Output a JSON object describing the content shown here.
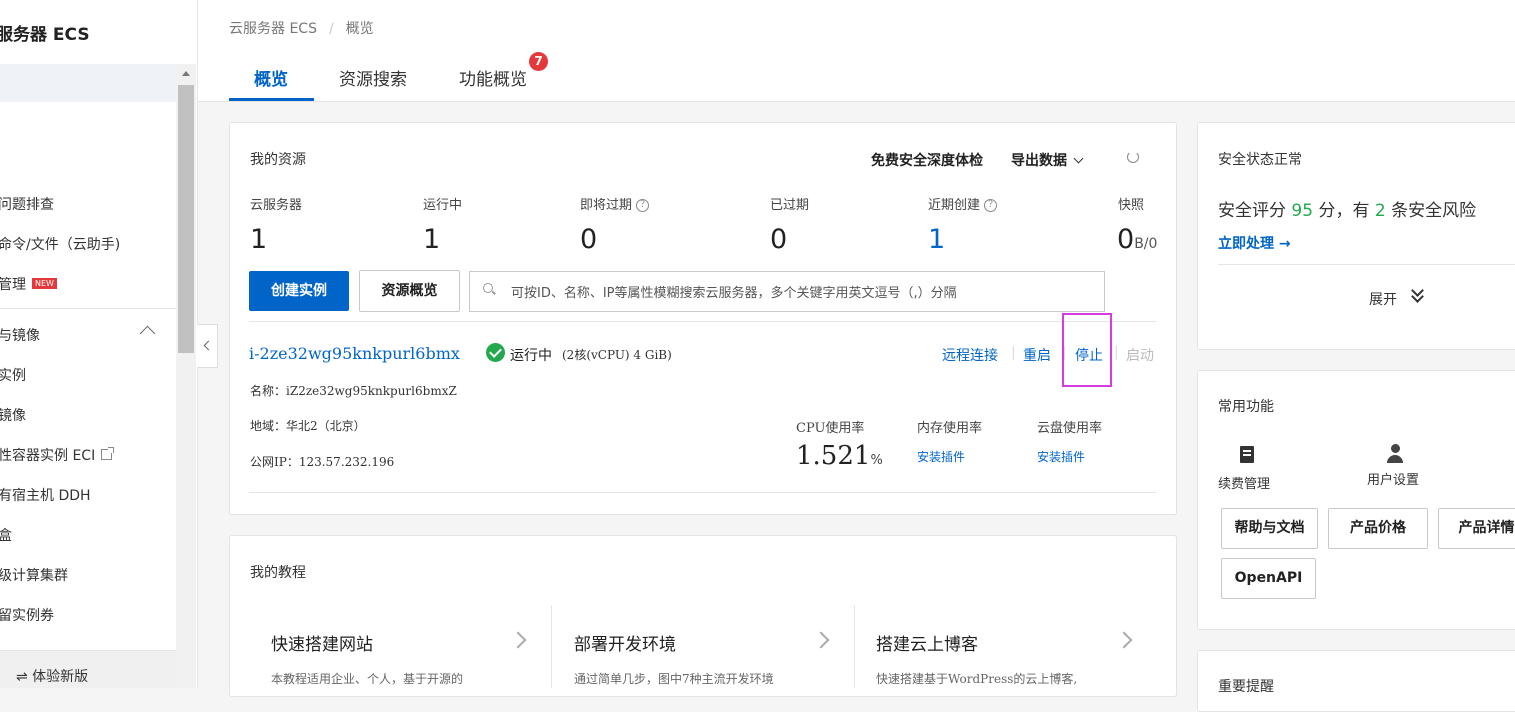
{
  "sidebar": {
    "title": "服务器 ECS",
    "items": [
      {
        "label": "问题排查"
      },
      {
        "label": "命令/文件（云助手)"
      },
      {
        "label": "管理",
        "badge": "NEW"
      },
      {
        "label": "与镜像"
      },
      {
        "label": "实例"
      },
      {
        "label": "镜像"
      },
      {
        "label": "性容器实例 ECI"
      },
      {
        "label": "有宿主机 DDH"
      },
      {
        "label": "盒"
      },
      {
        "label": "级计算集群"
      },
      {
        "label": "留实例券"
      }
    ],
    "bottom_label": "⇌ 体验新版"
  },
  "breadcrumb": {
    "root": "云服务器 ECS",
    "sep": "/",
    "current": "概览"
  },
  "tabs": [
    {
      "label": "概览"
    },
    {
      "label": "资源搜索"
    },
    {
      "label": "功能概览",
      "badge": "7"
    }
  ],
  "resources": {
    "title": "我的资源",
    "free_check": "免费安全深度体检",
    "export": "导出数据",
    "stats": [
      {
        "label": "云服务器",
        "value": "1"
      },
      {
        "label": "运行中",
        "value": "1"
      },
      {
        "label": "即将过期",
        "value": "0",
        "help": "?"
      },
      {
        "label": "已过期",
        "value": "0"
      },
      {
        "label": "近期创建",
        "value": "1",
        "help": "?"
      },
      {
        "label": "快照",
        "value": "0",
        "unit": "B/0"
      }
    ],
    "create_btn": "创建实例",
    "overview_btn": "资源概览",
    "search_placeholder": "可按ID、名称、IP等属性模糊搜索云服务器，多个关键字用英文逗号（,）分隔",
    "instance": {
      "id": "i-2ze32wg95knkpurl6bmx",
      "status": "运行中",
      "spec": "(2核(vCPU) 4 GiB)",
      "name_label": "名称：",
      "name": "iZ2ze32wg95knkpurl6bmxZ",
      "region_label": "地域：",
      "region": "华北2（北京）",
      "ip_label": "公网IP：",
      "ip": "123.57.232.196",
      "actions": {
        "remote": "远程连接",
        "restart": "重启",
        "stop": "停止",
        "start": "启动"
      },
      "cpu_label": "CPU使用率",
      "cpu_value": "1.521",
      "cpu_unit": "%",
      "mem_label": "内存使用率",
      "mem_action": "安装插件",
      "disk_label": "云盘使用率",
      "disk_action": "安装插件"
    }
  },
  "tutorials": {
    "title": "我的教程",
    "cards": [
      {
        "title": "快速搭建网站",
        "desc": "本教程适用企业、个人，基于开源的"
      },
      {
        "title": "部署开发环境",
        "desc": "通过简单几步，图中7种主流开发环境"
      },
      {
        "title": "搭建云上博客",
        "desc": "快速搭建基于WordPress的云上博客,"
      }
    ]
  },
  "security": {
    "title": "安全状态正常",
    "score_prefix": "安全评分",
    "score": "95",
    "score_mid": "分，有",
    "risks": "2",
    "score_suffix": "条安全风险",
    "handle": "立即处理 →",
    "expand": "展开"
  },
  "common": {
    "title": "常用功能",
    "renew": "续费管理",
    "user": "用户设置",
    "buttons": [
      "帮助与文档",
      "产品价格",
      "产品详情",
      "OpenAPI"
    ]
  },
  "next_card": {
    "title": "重要提醒"
  },
  "colors": {
    "primary": "#0064c8",
    "success": "#23a94d",
    "badge": "#e4393c",
    "highlight": "#d63be0"
  }
}
